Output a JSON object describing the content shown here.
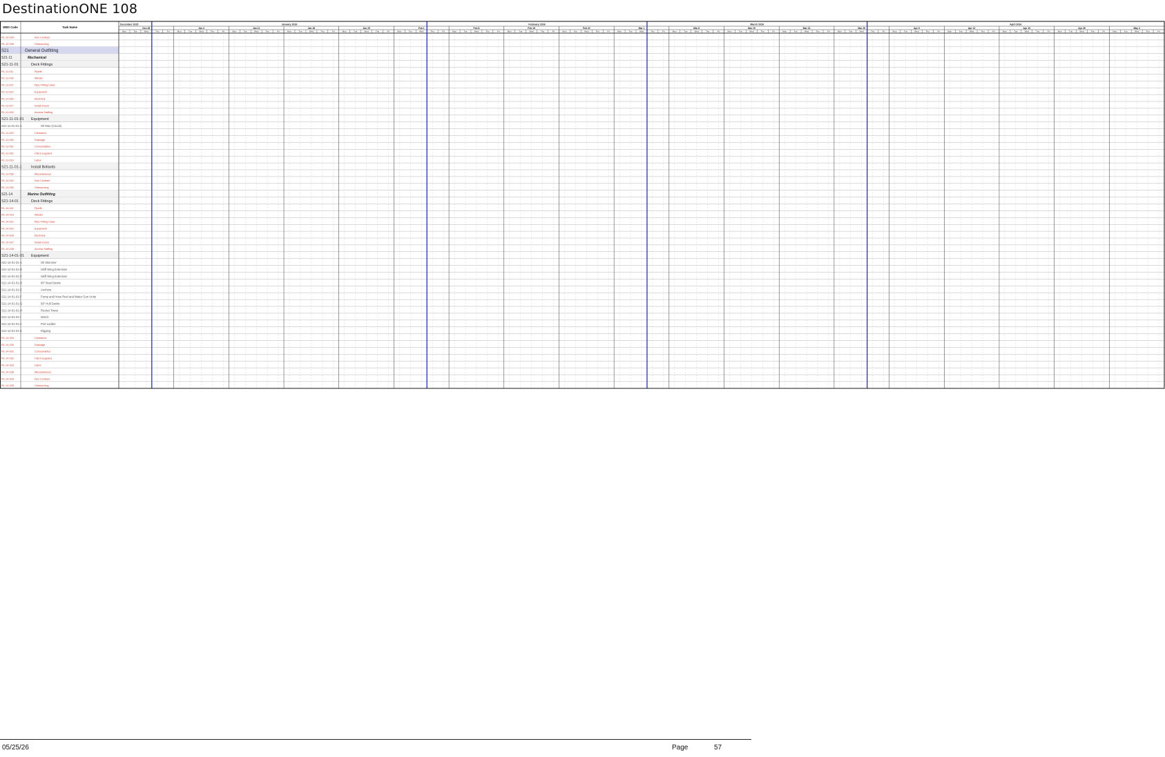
{
  "document": {
    "title": "DestinationONE 108"
  },
  "headers": {
    "wbs": "WBS Code",
    "task": "Task Name"
  },
  "months": [
    {
      "label": "December 2025"
    },
    {
      "label": "January 2026"
    },
    {
      "label": "February 2026"
    },
    {
      "label": "March 2026"
    },
    {
      "label": "April 2026"
    }
  ],
  "weeks": [
    "Dec 28",
    "Jan 4",
    "Jan 11",
    "Jan 18",
    "Jan 25",
    "Feb 1",
    "Feb 8",
    "Feb 15",
    "Feb 22",
    "Mar 1",
    "Mar 8",
    "Mar 15",
    "Mar 22",
    "Mar 29",
    "Apr 5",
    "Apr 12",
    "Apr 19",
    "Apr 26",
    "May 3"
  ],
  "day_labels": [
    "Mon",
    "Tue",
    "Wed",
    "Thu",
    "Fri"
  ],
  "rows": [
    {
      "code": "R1-10-034",
      "name": "Non Contract",
      "level": "detail"
    },
    {
      "code": "R1-10-035",
      "name": "Outsourcing",
      "level": "detail"
    },
    {
      "code": "S21",
      "name": "General Outfitting",
      "level": "group"
    },
    {
      "code": "S21-11",
      "name": "Mechanical",
      "level": "section"
    },
    {
      "code": "S21-11-01",
      "name": "Deck Fittings",
      "level": "sub"
    },
    {
      "code": "R1-11-011",
      "name": "Pipefit",
      "level": "detail"
    },
    {
      "code": "R1-11-016",
      "name": "Welder",
      "level": "detail"
    },
    {
      "code": "R1-11-021",
      "name": "Pipe Fitting Class",
      "level": "detail"
    },
    {
      "code": "R1-11-022",
      "name": "Equipment",
      "level": "detail"
    },
    {
      "code": "R1-11-026",
      "name": "Electrical",
      "level": "detail"
    },
    {
      "code": "R1-11-027",
      "name": "Install Doors",
      "level": "detail"
    },
    {
      "code": "R1-11-028",
      "name": "Access Staffing",
      "level": "detail"
    },
    {
      "code": "S21-11-01-01",
      "name": "Equipment",
      "level": "sub"
    },
    {
      "code": "S21-11-01-01-A",
      "name": "Oil Max (Circuit)",
      "level": "item"
    },
    {
      "code": "R1-11-029",
      "name": "Clearance",
      "level": "detail"
    },
    {
      "code": "R1-11-030",
      "name": "Drainage",
      "level": "detail"
    },
    {
      "code": "R1-11-031",
      "name": "Consumables",
      "level": "detail"
    },
    {
      "code": "R1-11-032",
      "name": "Client supplied",
      "level": "detail"
    },
    {
      "code": "R1-11-033",
      "name": "Labor",
      "level": "detail"
    },
    {
      "code": "S21-11-01-1",
      "name": "Install Bollards",
      "level": "sub"
    },
    {
      "code": "R1-11-036",
      "name": "Miscellaneous",
      "level": "detail"
    },
    {
      "code": "R1-11-034",
      "name": "Non Contract",
      "level": "detail"
    },
    {
      "code": "R1-11-035",
      "name": "Outsourcing",
      "level": "detail"
    },
    {
      "code": "S21-14",
      "name": "Marine Outfitting",
      "level": "section"
    },
    {
      "code": "S21-14-01",
      "name": "Deck Fittings",
      "level": "sub"
    },
    {
      "code": "R1-14-011",
      "name": "Pipefit",
      "level": "detail"
    },
    {
      "code": "R1-14-016",
      "name": "Welder",
      "level": "detail"
    },
    {
      "code": "R1-14-021",
      "name": "Pipe Fitting Class",
      "level": "detail"
    },
    {
      "code": "R1-14-022",
      "name": "Equipment",
      "level": "detail"
    },
    {
      "code": "R1-14-026",
      "name": "Electrical",
      "level": "detail"
    },
    {
      "code": "R1-14-027",
      "name": "Install Doors",
      "level": "detail"
    },
    {
      "code": "R1-14-028",
      "name": "Access Staffing",
      "level": "detail"
    },
    {
      "code": "S21-14-01-01",
      "name": "Equipment",
      "level": "sub"
    },
    {
      "code": "S21-14-01-01-A",
      "name": "Oil Skimmer",
      "level": "item"
    },
    {
      "code": "S21-14-01-01-B",
      "name": "Skiff Wing Extension",
      "level": "item"
    },
    {
      "code": "S21-14-01-01-C",
      "name": "Skiff Wing Extension",
      "level": "item"
    },
    {
      "code": "S21-14-01-01-D",
      "name": "60\" Boat Davits",
      "level": "item"
    },
    {
      "code": "S21-14-01-01-E",
      "name": "Anchors",
      "level": "item"
    },
    {
      "code": "S21-14-01-01-F",
      "name": "Pump and Hose Reel and Water Gun Units",
      "level": "item"
    },
    {
      "code": "S21-14-01-01-G",
      "name": "58\" Hull Davits",
      "level": "item"
    },
    {
      "code": "S21-14-01-01-H",
      "name": "Rocket Tower",
      "level": "item"
    },
    {
      "code": "S21-14-01-01-I",
      "name": "Winch",
      "level": "item"
    },
    {
      "code": "S21-14-01-01-J",
      "name": "Port Ladder",
      "level": "item"
    },
    {
      "code": "S21-14-01-01-K",
      "name": "Rigging",
      "level": "item"
    },
    {
      "code": "R1-14-029",
      "name": "Clearance",
      "level": "detail"
    },
    {
      "code": "R1-14-030",
      "name": "Drainage",
      "level": "detail"
    },
    {
      "code": "R1-14-031",
      "name": "Consumables",
      "level": "detail"
    },
    {
      "code": "R1-14-032",
      "name": "Client supplied",
      "level": "detail"
    },
    {
      "code": "R1-14-033",
      "name": "Labor",
      "level": "detail"
    },
    {
      "code": "R1-14-036",
      "name": "Miscellaneous",
      "level": "detail"
    },
    {
      "code": "R1-14-034",
      "name": "Non Contract",
      "level": "detail"
    },
    {
      "code": "R1-14-035",
      "name": "Outsourcing",
      "level": "detail"
    }
  ],
  "footer": {
    "date": "05/25/26",
    "page_label": "Page",
    "page_number": "57"
  },
  "colors": {
    "grid_line": "#b5b5b5",
    "month_separator": "#2a2ea8",
    "detail_text": "#d03a2c",
    "group_fill": "#d5d8ef",
    "sub_fill": "#f2f2f2",
    "header_text": "#111111"
  }
}
